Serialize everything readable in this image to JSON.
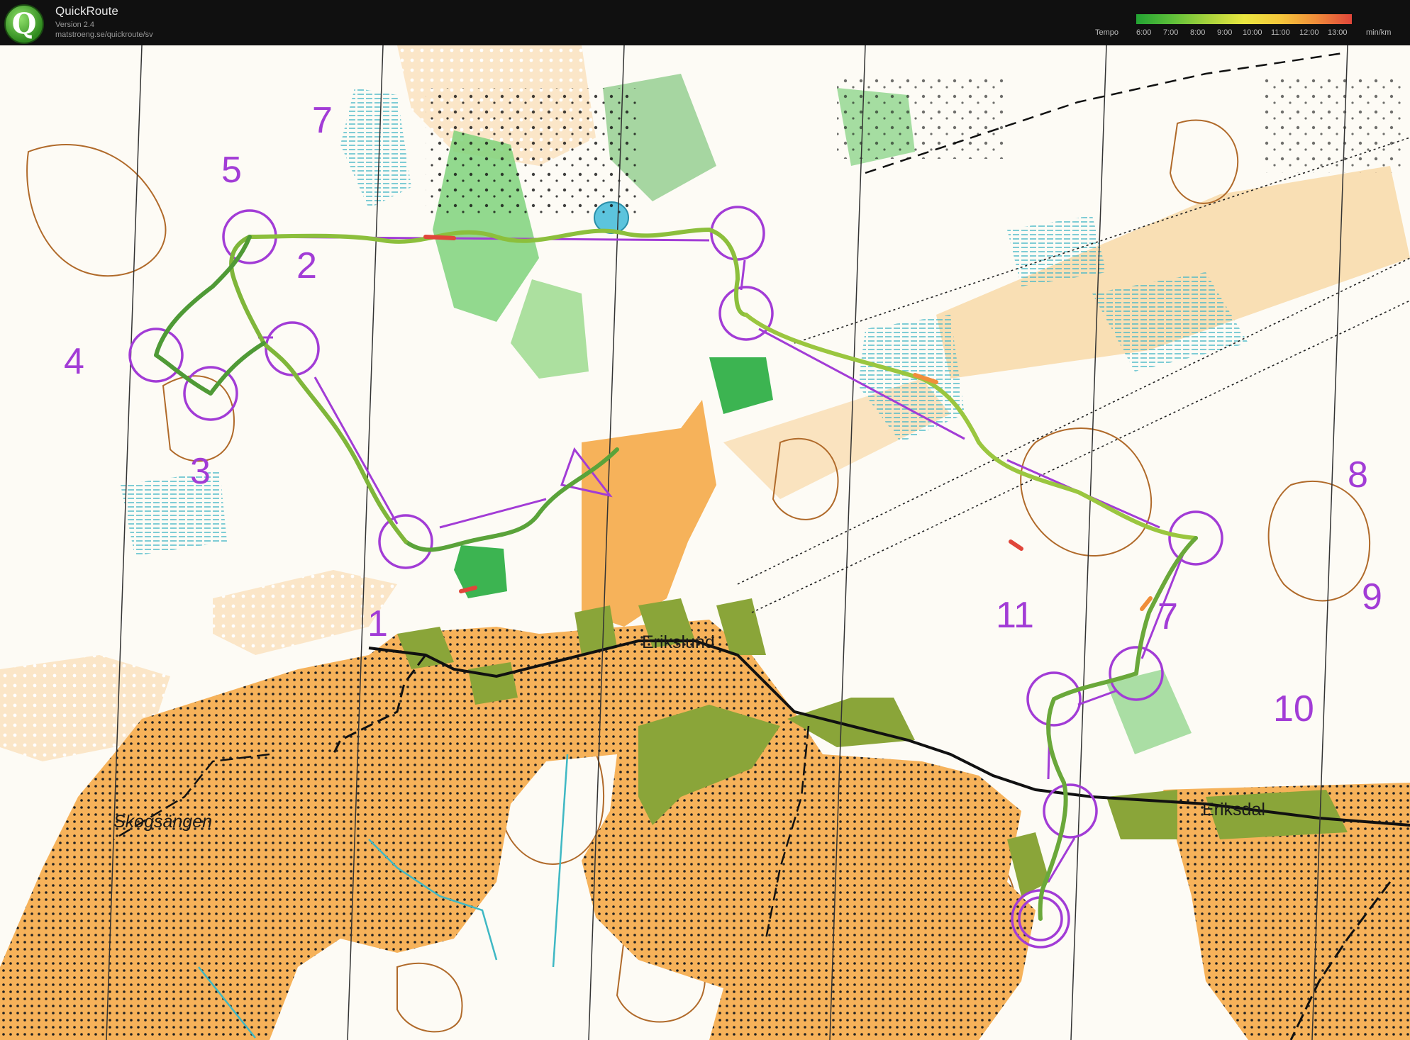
{
  "app": {
    "title": "QuickRoute",
    "version": "Version 2.4",
    "url": "matstroeng.se/quickroute/sv"
  },
  "legend": {
    "label": "Tempo",
    "ticks": [
      "6:00",
      "7:00",
      "8:00",
      "9:00",
      "10:00",
      "11:00",
      "12:00",
      "13:00"
    ],
    "unit": "min/km",
    "colors": [
      "#23a333",
      "#5fc03a",
      "#a6d23c",
      "#e9e640",
      "#f5c63b",
      "#f08e3a",
      "#e0463a"
    ]
  },
  "map": {
    "control_color": "#a23cd6",
    "controls": [
      "1",
      "2",
      "3",
      "4",
      "5",
      "7",
      "7",
      "8",
      "9",
      "10",
      "11"
    ],
    "place_names": [
      "Erikslund",
      "Eriksdal",
      "Skogsängen"
    ]
  }
}
